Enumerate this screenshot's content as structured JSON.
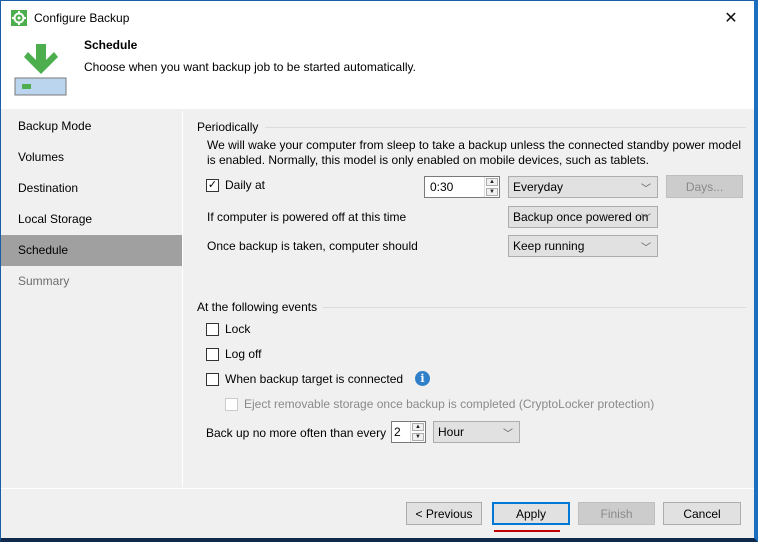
{
  "window": {
    "title": "Configure Backup",
    "close_label": "✕"
  },
  "header": {
    "title": "Schedule",
    "description": "Choose when you want backup job to be started automatically."
  },
  "sidebar": {
    "items": [
      {
        "label": "Backup Mode",
        "state": "normal"
      },
      {
        "label": "Volumes",
        "state": "normal"
      },
      {
        "label": "Destination",
        "state": "normal"
      },
      {
        "label": "Local Storage",
        "state": "normal"
      },
      {
        "label": "Schedule",
        "state": "active"
      },
      {
        "label": "Summary",
        "state": "disabled"
      }
    ]
  },
  "periodically": {
    "group_title": "Periodically",
    "description": "We will wake your computer from sleep to take a backup unless the connected standby power model is enabled. Normally, this model is only enabled on mobile devices, such as tablets.",
    "daily_checkbox": {
      "label": "Daily at",
      "checked": true
    },
    "time_value": "0:30",
    "frequency_select": "Everyday",
    "days_button": "Days...",
    "powered_off_label": "If computer is powered off at this time",
    "powered_off_select": "Backup once powered on",
    "after_backup_label": "Once backup is taken, computer should",
    "after_backup_select": "Keep running"
  },
  "events": {
    "group_title": "At the following events",
    "lock": {
      "label": "Lock",
      "checked": false
    },
    "logoff": {
      "label": "Log off",
      "checked": false
    },
    "target_connected": {
      "label": "When backup target is connected",
      "checked": false
    },
    "eject": {
      "label": "Eject removable storage once backup is completed (CryptoLocker protection)",
      "checked": false,
      "enabled": false
    },
    "limit_label": "Back up no more often than every",
    "limit_value": "2",
    "limit_unit": "Hour"
  },
  "footer": {
    "previous": "< Previous",
    "apply": "Apply",
    "finish": "Finish",
    "cancel": "Cancel"
  },
  "colors": {
    "accent": "#0078d7",
    "brand_green": "#4cae4c",
    "selected_nav": "#a0a0a0",
    "annotation_underline": "#c00000"
  }
}
